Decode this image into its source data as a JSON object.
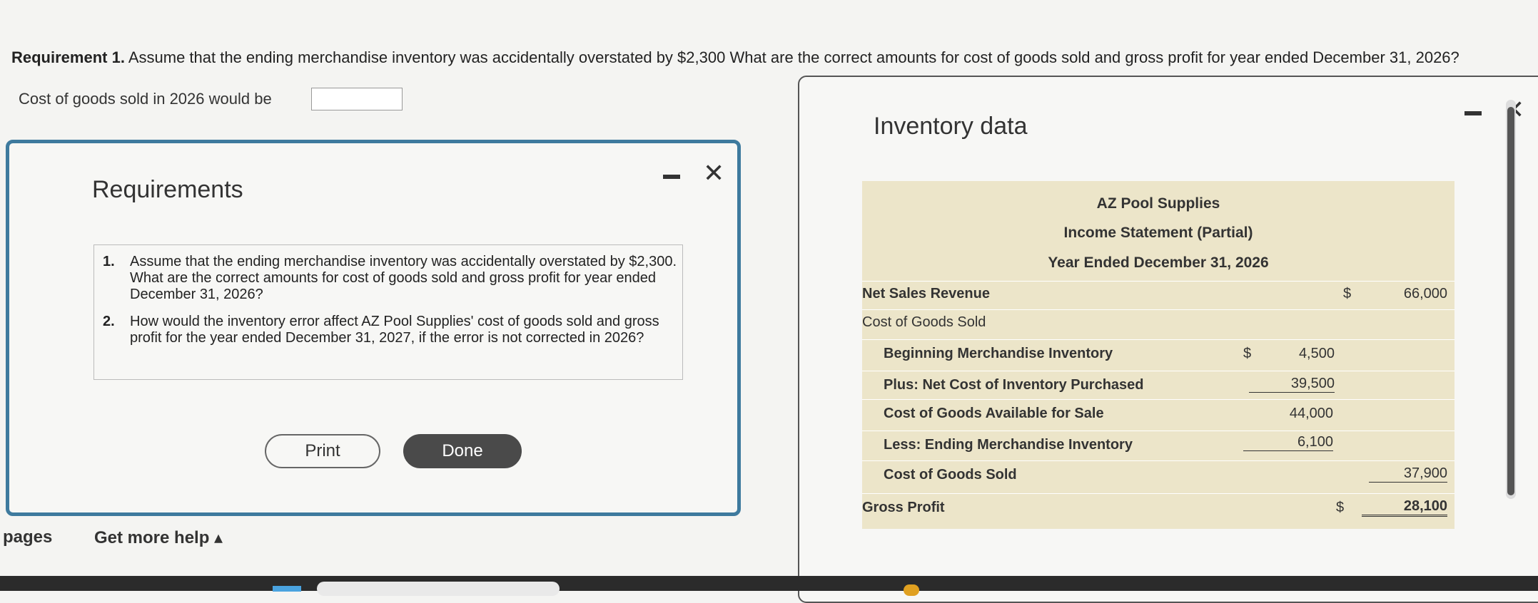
{
  "question": {
    "lead": "Requirement 1.",
    "text": "Assume that the ending merchandise inventory was accidentally overstated by $2,300  What are the correct amounts for cost of goods sold and gross profit for year ended December 31, 2026?"
  },
  "cogs_prompt": {
    "label": "Cost of goods sold in 2026 would be",
    "value": ""
  },
  "requirements_dialog": {
    "title": "Requirements",
    "items": [
      {
        "num": "1.",
        "text": "Assume that the ending merchandise inventory was accidentally overstated by $2,300. What are the correct amounts for cost of goods sold and gross profit for year ended December 31, 2026?"
      },
      {
        "num": "2.",
        "text": "How would the inventory error affect AZ Pool Supplies' cost of goods sold and gross profit for the year ended December 31, 2027, if the error is not corrected in 2026?"
      }
    ],
    "print_label": "Print",
    "done_label": "Done"
  },
  "footer": {
    "pages": "pages",
    "help": "Get more help ▴"
  },
  "inventory_panel": {
    "title": "Inventory data",
    "company": "AZ Pool Supplies",
    "statement": "Income Statement (Partial)",
    "period": "Year Ended December 31, 2026",
    "rows": {
      "net_sales": {
        "label": "Net Sales Revenue",
        "sym": "$",
        "value": "66,000"
      },
      "cogs_header": {
        "label": "Cost of Goods Sold"
      },
      "beginning": {
        "label": "Beginning Merchandise Inventory",
        "sym": "$",
        "value": "4,500"
      },
      "purchases": {
        "label": "Plus: Net Cost of Inventory Purchased",
        "value": "39,500"
      },
      "available": {
        "label": "Cost of Goods Available for Sale",
        "value": "44,000"
      },
      "ending": {
        "label": "Less: Ending Merchandise Inventory",
        "value": "6,100"
      },
      "cogs_total": {
        "label": "Cost of Goods Sold",
        "value": "37,900"
      },
      "gross_profit": {
        "label": "Gross Profit",
        "sym": "$",
        "value": "28,100"
      }
    }
  },
  "window_controls": {
    "minimize": "▬",
    "close": "✕"
  }
}
